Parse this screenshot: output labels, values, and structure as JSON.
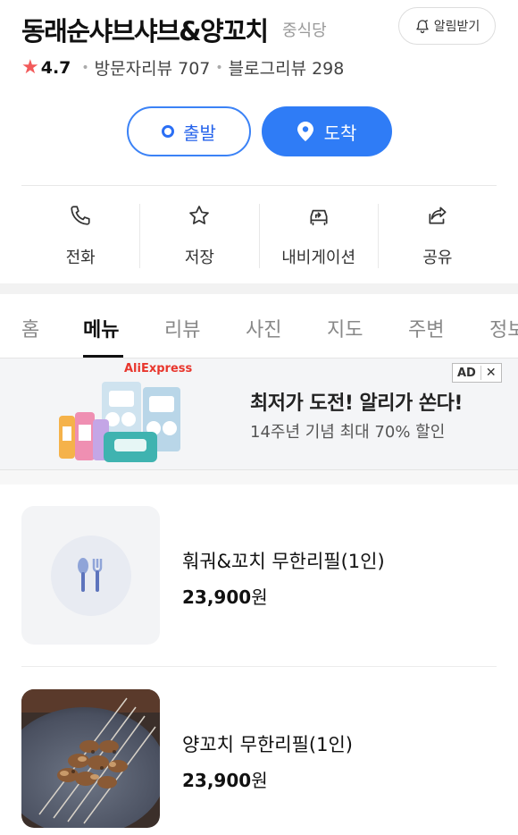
{
  "place": {
    "name": "동래순샤브샤브&양꼬치",
    "category": "중식당",
    "alarm_label": "알림받기",
    "rating": "4.7",
    "visitor_reviews": "방문자리뷰 707",
    "blog_reviews": "블로그리뷰 298"
  },
  "route": {
    "depart_label": "출발",
    "arrive_label": "도착"
  },
  "actions": [
    {
      "label": "전화",
      "icon": "phone-icon"
    },
    {
      "label": "저장",
      "icon": "star-outline-icon"
    },
    {
      "label": "내비게이션",
      "icon": "navigation-car-icon"
    },
    {
      "label": "공유",
      "icon": "share-icon"
    }
  ],
  "tabs": [
    "홈",
    "메뉴",
    "리뷰",
    "사진",
    "지도",
    "주변",
    "정보"
  ],
  "active_tab": "메뉴",
  "ad": {
    "brand": "AliExpress",
    "tag": "AD",
    "close": "✕",
    "headline": "최저가 도전! 알리가 쏜다!",
    "subline": "14주년 기념 최대 70% 할인"
  },
  "menu": [
    {
      "name": "훠궈&꼬치 무한리필(1인)",
      "price": "23,900",
      "unit": "원",
      "thumb": "placeholder-utensils"
    },
    {
      "name": "양꼬치 무한리필(1인)",
      "price": "23,900",
      "unit": "원",
      "thumb": "lamb-skewer-photo"
    }
  ],
  "colors": {
    "accent": "#2f7cf6",
    "star": "#f25a5a",
    "ad_brand": "#e8362d"
  }
}
